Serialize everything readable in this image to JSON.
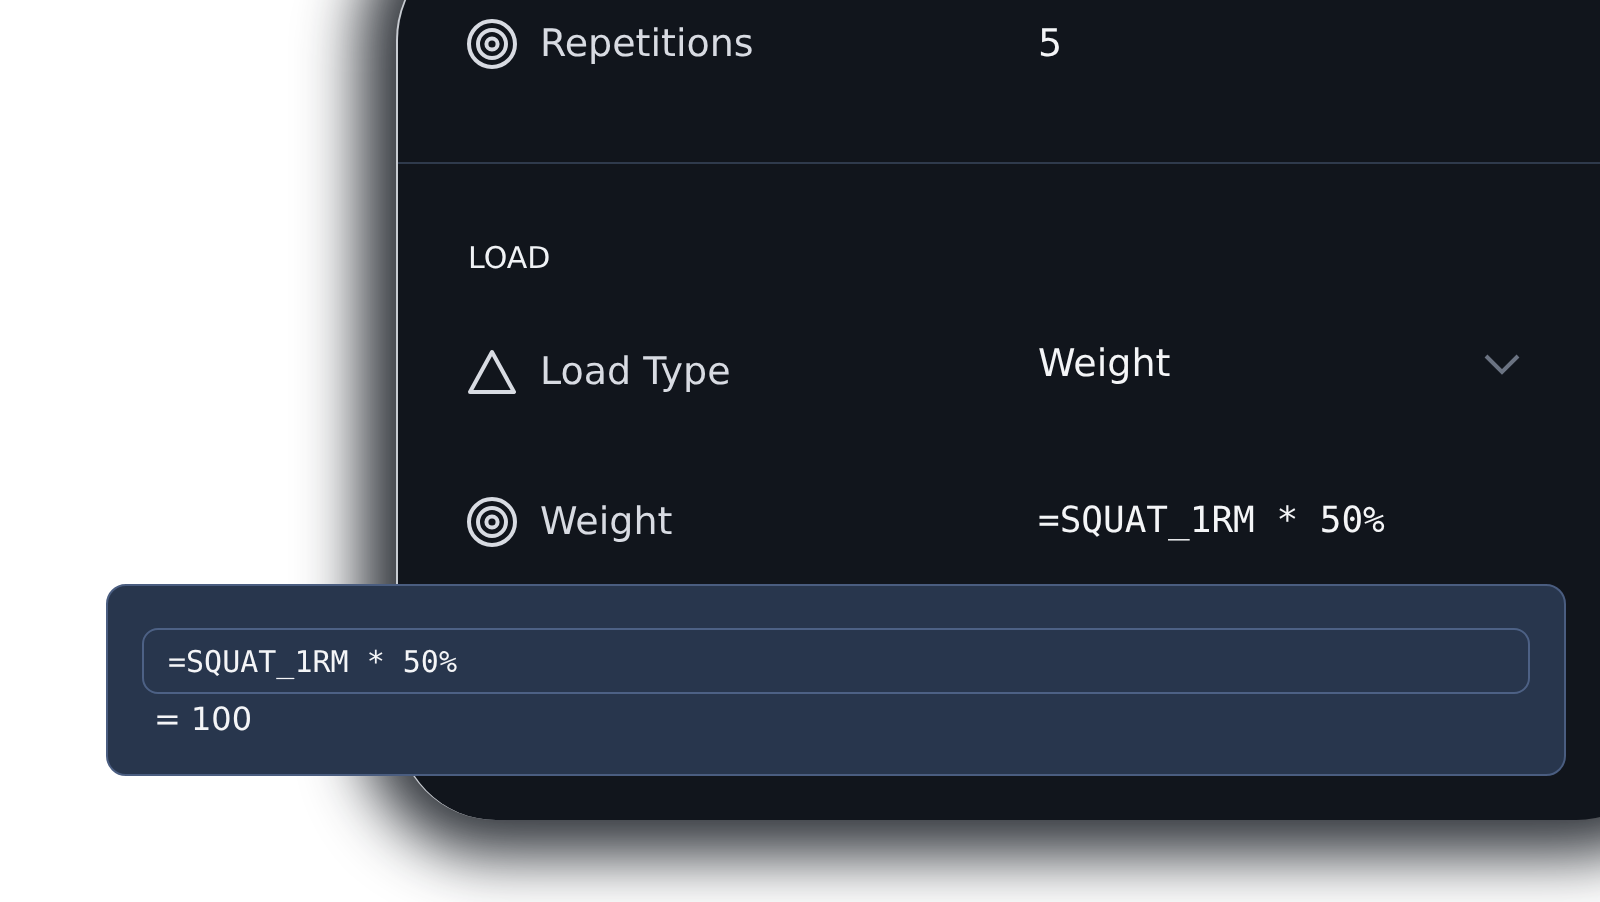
{
  "top_fields": [
    {
      "kind": "number",
      "label": "Repetitions",
      "value": "5"
    }
  ],
  "section": {
    "title": "LOAD"
  },
  "fields": [
    {
      "kind": "select",
      "label": "Load Type",
      "value": "Weight"
    },
    {
      "kind": "formula",
      "label": "Weight",
      "value": "=SQUAT_1RM * 50%"
    }
  ],
  "formula_popup": {
    "expression": "=SQUAT_1RM * 50%",
    "result": "= 100"
  }
}
